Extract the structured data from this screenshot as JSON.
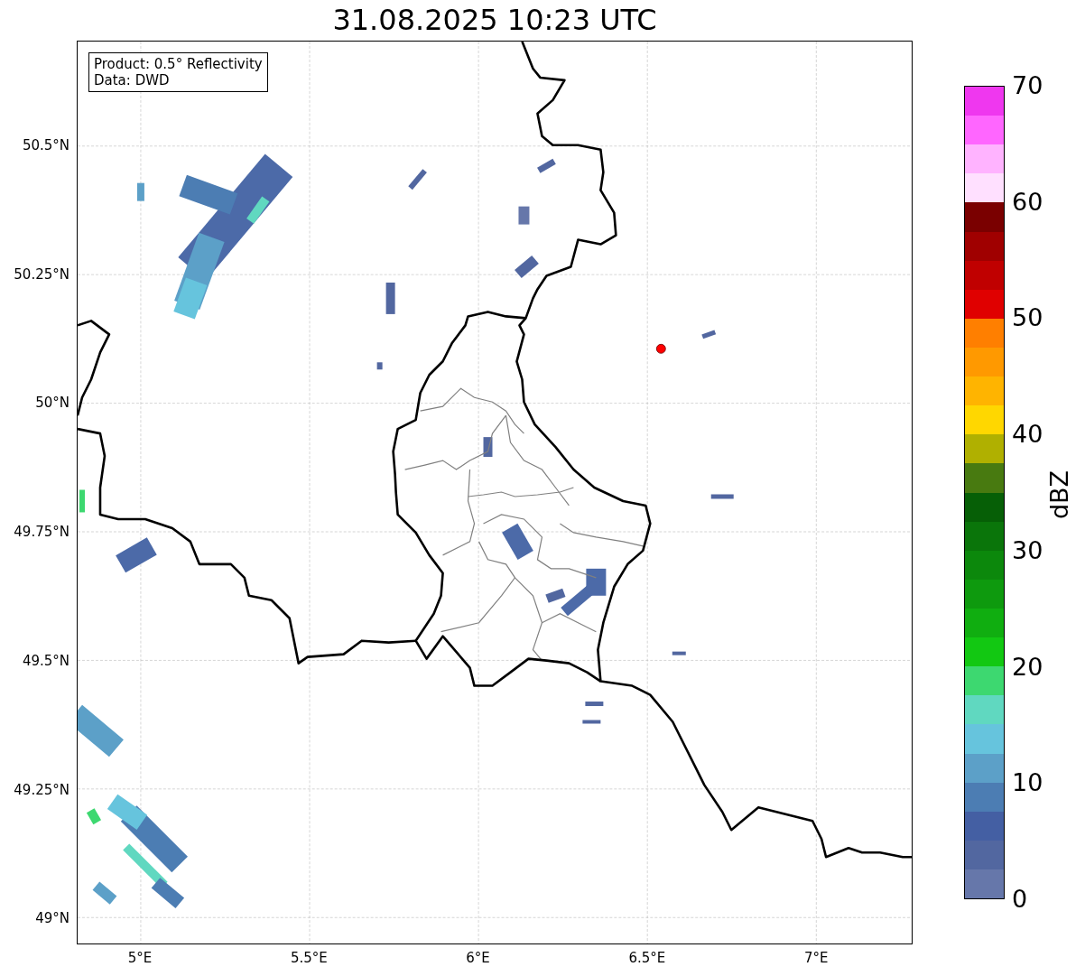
{
  "title": "31.08.2025 10:23 UTC",
  "legend_lines": [
    "Product: 0.5° Reflectivity",
    "Data: DWD"
  ],
  "y_ticks": [
    "50.5°N",
    "50.25°N",
    "50°N",
    "49.75°N",
    "49.5°N",
    "49.25°N",
    "49°N"
  ],
  "x_ticks": [
    "5°E",
    "5.5°E",
    "6°E",
    "6.5°E",
    "7°E"
  ],
  "colorbar": {
    "label": "dBZ",
    "ticks": [
      "70",
      "60",
      "50",
      "40",
      "30",
      "20",
      "10",
      "0"
    ],
    "segments": [
      {
        "color": "#ef37ef"
      },
      {
        "color": "#ff66ff"
      },
      {
        "color": "#ffb3ff"
      },
      {
        "color": "#ffe0ff"
      },
      {
        "color": "#7a0000"
      },
      {
        "color": "#a00000"
      },
      {
        "color": "#c00000"
      },
      {
        "color": "#e00000"
      },
      {
        "color": "#ff7f00"
      },
      {
        "color": "#ff9900"
      },
      {
        "color": "#ffb400"
      },
      {
        "color": "#ffd700"
      },
      {
        "color": "#b0b000"
      },
      {
        "color": "#487a10"
      },
      {
        "color": "#065f06"
      },
      {
        "color": "#0a750a"
      },
      {
        "color": "#0c880c"
      },
      {
        "color": "#0e9a0e"
      },
      {
        "color": "#10ae10"
      },
      {
        "color": "#12c812"
      },
      {
        "color": "#3dd870"
      },
      {
        "color": "#60d8c0"
      },
      {
        "color": "#66c4dd"
      },
      {
        "color": "#5ca0c8"
      },
      {
        "color": "#4c7db3"
      },
      {
        "color": "#445fa3"
      },
      {
        "color": "#5267a0"
      },
      {
        "color": "#6677aa"
      }
    ]
  }
}
